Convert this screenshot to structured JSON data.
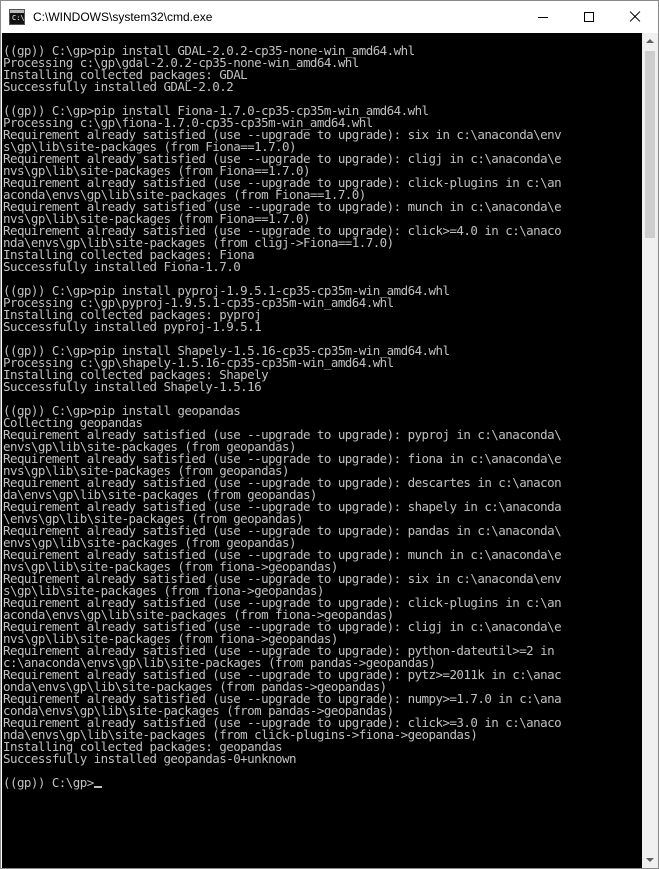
{
  "window": {
    "title": "C:\\WINDOWS\\system32\\cmd.exe",
    "icon": "cmd-icon",
    "icon_prompt": "C:\\"
  },
  "controls": {
    "minimize_icon": "minimize-icon",
    "maximize_icon": "maximize-icon",
    "close_icon": "close-icon"
  },
  "console": {
    "background": "#000000",
    "foreground": "#c0c0c0",
    "lines": [
      "((gp)) C:\\gp>pip install GDAL-2.0.2-cp35-none-win_amd64.whl",
      "Processing c:\\gp\\gdal-2.0.2-cp35-none-win_amd64.whl",
      "Installing collected packages: GDAL",
      "Successfully installed GDAL-2.0.2",
      "",
      "((gp)) C:\\gp>pip install Fiona-1.7.0-cp35-cp35m-win_amd64.whl",
      "Processing c:\\gp\\fiona-1.7.0-cp35-cp35m-win_amd64.whl",
      "Requirement already satisfied (use --upgrade to upgrade): six in c:\\anaconda\\env",
      "s\\gp\\lib\\site-packages (from Fiona==1.7.0)",
      "Requirement already satisfied (use --upgrade to upgrade): cligj in c:\\anaconda\\e",
      "nvs\\gp\\lib\\site-packages (from Fiona==1.7.0)",
      "Requirement already satisfied (use --upgrade to upgrade): click-plugins in c:\\an",
      "aconda\\envs\\gp\\lib\\site-packages (from Fiona==1.7.0)",
      "Requirement already satisfied (use --upgrade to upgrade): munch in c:\\anaconda\\e",
      "nvs\\gp\\lib\\site-packages (from Fiona==1.7.0)",
      "Requirement already satisfied (use --upgrade to upgrade): click>=4.0 in c:\\anaco",
      "nda\\envs\\gp\\lib\\site-packages (from cligj->Fiona==1.7.0)",
      "Installing collected packages: Fiona",
      "Successfully installed Fiona-1.7.0",
      "",
      "((gp)) C:\\gp>pip install pyproj-1.9.5.1-cp35-cp35m-win_amd64.whl",
      "Processing c:\\gp\\pyproj-1.9.5.1-cp35-cp35m-win_amd64.whl",
      "Installing collected packages: pyproj",
      "Successfully installed pyproj-1.9.5.1",
      "",
      "((gp)) C:\\gp>pip install Shapely-1.5.16-cp35-cp35m-win_amd64.whl",
      "Processing c:\\gp\\shapely-1.5.16-cp35-cp35m-win_amd64.whl",
      "Installing collected packages: Shapely",
      "Successfully installed Shapely-1.5.16",
      "",
      "((gp)) C:\\gp>pip install geopandas",
      "Collecting geopandas",
      "Requirement already satisfied (use --upgrade to upgrade): pyproj in c:\\anaconda\\",
      "envs\\gp\\lib\\site-packages (from geopandas)",
      "Requirement already satisfied (use --upgrade to upgrade): fiona in c:\\anaconda\\e",
      "nvs\\gp\\lib\\site-packages (from geopandas)",
      "Requirement already satisfied (use --upgrade to upgrade): descartes in c:\\anacon",
      "da\\envs\\gp\\lib\\site-packages (from geopandas)",
      "Requirement already satisfied (use --upgrade to upgrade): shapely in c:\\anaconda",
      "\\envs\\gp\\lib\\site-packages (from geopandas)",
      "Requirement already satisfied (use --upgrade to upgrade): pandas in c:\\anaconda\\",
      "envs\\gp\\lib\\site-packages (from geopandas)",
      "Requirement already satisfied (use --upgrade to upgrade): munch in c:\\anaconda\\e",
      "nvs\\gp\\lib\\site-packages (from fiona->geopandas)",
      "Requirement already satisfied (use --upgrade to upgrade): six in c:\\anaconda\\env",
      "s\\gp\\lib\\site-packages (from fiona->geopandas)",
      "Requirement already satisfied (use --upgrade to upgrade): click-plugins in c:\\an",
      "aconda\\envs\\gp\\lib\\site-packages (from fiona->geopandas)",
      "Requirement already satisfied (use --upgrade to upgrade): cligj in c:\\anaconda\\e",
      "nvs\\gp\\lib\\site-packages (from fiona->geopandas)",
      "Requirement already satisfied (use --upgrade to upgrade): python-dateutil>=2 in",
      "c:\\anaconda\\envs\\gp\\lib\\site-packages (from pandas->geopandas)",
      "Requirement already satisfied (use --upgrade to upgrade): pytz>=2011k in c:\\anac",
      "onda\\envs\\gp\\lib\\site-packages (from pandas->geopandas)",
      "Requirement already satisfied (use --upgrade to upgrade): numpy>=1.7.0 in c:\\ana",
      "conda\\envs\\gp\\lib\\site-packages (from pandas->geopandas)",
      "Requirement already satisfied (use --upgrade to upgrade): click>=3.0 in c:\\anaco",
      "nda\\envs\\gp\\lib\\site-packages (from click-plugins->fiona->geopandas)",
      "Installing collected packages: geopandas",
      "Successfully installed geopandas-0+unknown",
      ""
    ],
    "prompt": "((gp)) C:\\gp>"
  },
  "scrollbar": {
    "up_icon": "scroll-up-arrow-icon",
    "down_icon": "scroll-down-arrow-icon"
  }
}
